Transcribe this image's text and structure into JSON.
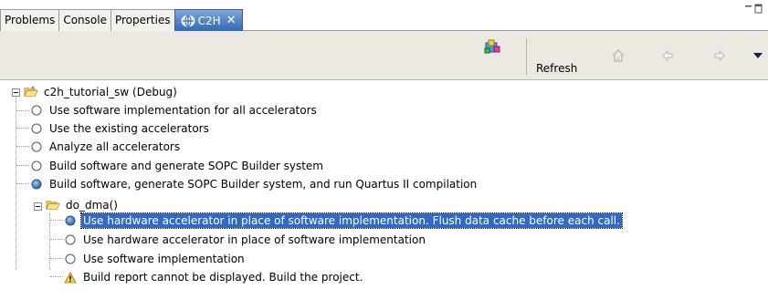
{
  "tabs": [
    {
      "label": "Problems",
      "active": false
    },
    {
      "label": "Console",
      "active": false
    },
    {
      "label": "Properties",
      "active": false
    },
    {
      "label": "C2H",
      "active": true
    }
  ],
  "toolbar": {
    "refresh_label": "Refresh",
    "icons": [
      "build-icon",
      "home-icon",
      "back-arrow-icon",
      "forward-arrow-icon",
      "view-menu-icon"
    ]
  },
  "tree": {
    "root_label": "c2h_tutorial_sw (Debug)",
    "root_options": [
      {
        "label": "Use software implementation for all accelerators",
        "selected": false
      },
      {
        "label": "Use the existing accelerators",
        "selected": false
      },
      {
        "label": "Analyze all accelerators",
        "selected": false
      },
      {
        "label": "Build software and generate SOPC Builder system",
        "selected": false
      },
      {
        "label": "Build software, generate SOPC Builder system, and run Quartus II compilation",
        "selected": true
      }
    ],
    "function_label": "do_dma()",
    "function_options": [
      {
        "label": "Use hardware accelerator in place of software implementation. Flush data cache before each call.",
        "selected": true,
        "highlighted": true
      },
      {
        "label": "Use hardware accelerator in place of software implementation",
        "selected": false
      },
      {
        "label": "Use software implementation",
        "selected": false
      }
    ],
    "warning_label": "Build report cannot be displayed.  Build the project."
  },
  "colors": {
    "tab_active_top": "#7fa6d8",
    "tab_active_bottom": "#2f68b8",
    "toolbar_bg": "#ece9e2",
    "selection": "#316ac5",
    "radio_on": "#3a72c4",
    "folder": "#f5cf5a"
  }
}
